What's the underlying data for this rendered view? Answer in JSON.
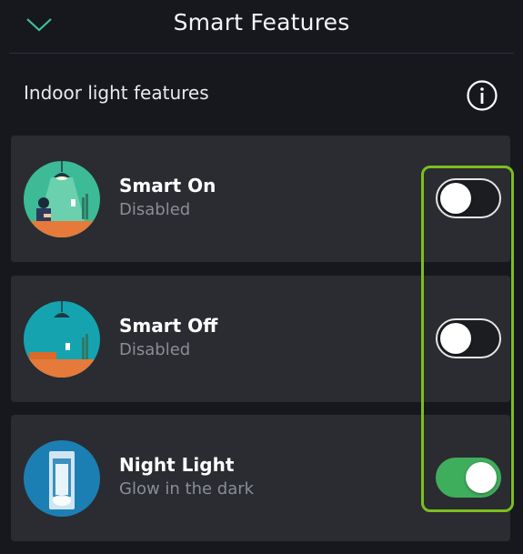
{
  "header": {
    "title": "Smart Features",
    "back_icon": "chevron-down-icon"
  },
  "section": {
    "title": "Indoor light features",
    "info_icon": "info-icon"
  },
  "features": [
    {
      "name": "Smart On",
      "status": "Disabled",
      "enabled": false
    },
    {
      "name": "Smart Off",
      "status": "Disabled",
      "enabled": false
    },
    {
      "name": "Night Light",
      "status": "Glow in the dark",
      "enabled": true
    }
  ],
  "colors": {
    "background": "#16181d",
    "card": "#2a2c31",
    "toggle_on": "#3fae5c",
    "highlight": "#7bbf1e",
    "secondary_text": "#8a8e94"
  }
}
